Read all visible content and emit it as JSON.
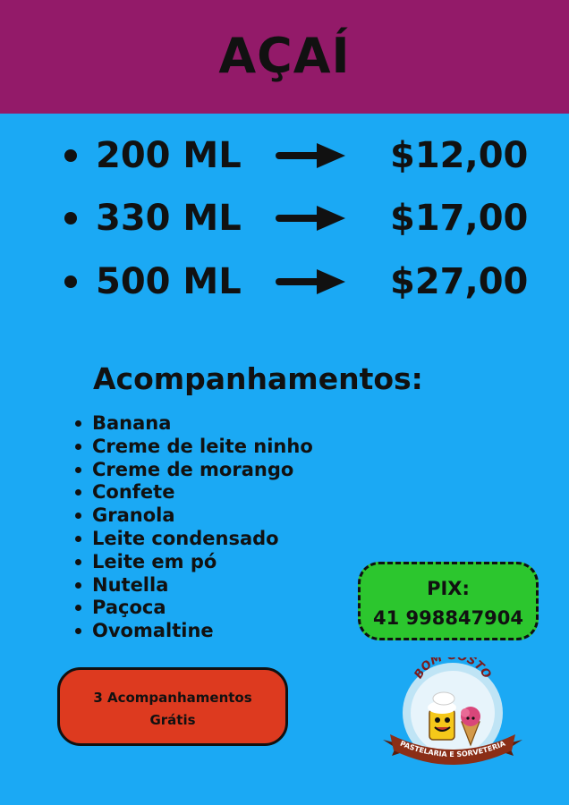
{
  "header": {
    "title": "AÇAÍ",
    "background_color": "#931a69"
  },
  "page": {
    "background_color": "#1ba9f4"
  },
  "prices": [
    {
      "size": "200 ML",
      "price": "$12,00"
    },
    {
      "size": "330 ML",
      "price": "$17,00"
    },
    {
      "size": "500 ML",
      "price": "$27,00"
    }
  ],
  "arrow_icon": "right-arrow-icon",
  "acompanhamentos": {
    "title": "Acompanhamentos:",
    "items": [
      "Banana",
      "Creme de leite ninho",
      "Creme de morango",
      "Confete",
      "Granola",
      "Leite condensado",
      "Leite em pó",
      "Nutella",
      "Paçoca",
      "Ovomaltine"
    ]
  },
  "pix": {
    "label": "PIX:",
    "number": "41 998847904",
    "color": "#2cc62e"
  },
  "promo": {
    "line1": "3 Acompanhamentos",
    "line2": "Grátis",
    "color": "#dd3a1f"
  },
  "logo": {
    "icon": "bom-gosto-logo",
    "name": "BOM GOSTO",
    "subtitle": "PASTELARIA E SORVETERIA"
  }
}
